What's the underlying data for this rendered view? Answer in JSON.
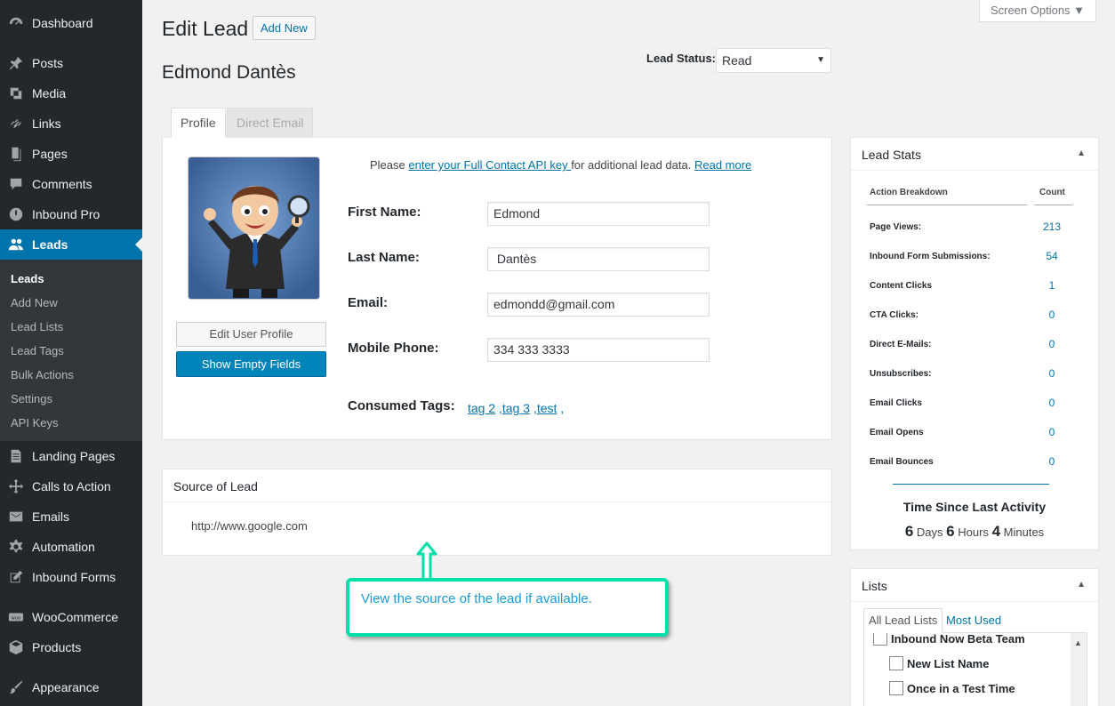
{
  "sidebar": {
    "items": [
      {
        "label": "Dashboard",
        "icon": "dashboard-icon"
      },
      {
        "label": "Posts",
        "icon": "pin-icon"
      },
      {
        "label": "Media",
        "icon": "media-icon"
      },
      {
        "label": "Links",
        "icon": "link-icon"
      },
      {
        "label": "Pages",
        "icon": "page-icon"
      },
      {
        "label": "Comments",
        "icon": "comment-icon"
      },
      {
        "label": "Inbound Pro",
        "icon": "power-icon"
      },
      {
        "label": "Leads",
        "icon": "users-icon"
      },
      {
        "label": "Landing Pages",
        "icon": "document-icon"
      },
      {
        "label": "Calls to Action",
        "icon": "move-icon"
      },
      {
        "label": "Emails",
        "icon": "envelope-icon"
      },
      {
        "label": "Automation",
        "icon": "gear-icon"
      },
      {
        "label": "Inbound Forms",
        "icon": "edit-icon"
      },
      {
        "label": "WooCommerce",
        "icon": "woo-icon"
      },
      {
        "label": "Products",
        "icon": "box-icon"
      },
      {
        "label": "Appearance",
        "icon": "brush-icon"
      }
    ],
    "submenu": [
      "Leads",
      "Add New",
      "Lead Lists",
      "Lead Tags",
      "Bulk Actions",
      "Settings",
      "API Keys"
    ]
  },
  "header": {
    "title": "Edit Lead",
    "add_new": "Add New",
    "screen_options": "Screen Options ▼",
    "lead_name": "Edmond Dantès",
    "lead_status_label": "Lead Status:",
    "lead_status_value": "Read"
  },
  "tabs": {
    "profile": "Profile",
    "direct_email": "Direct Email"
  },
  "profile": {
    "notice_prefix": "Please ",
    "notice_link": "enter your Full Contact API key ",
    "notice_mid": "for additional lead data. ",
    "notice_more": "Read more",
    "edit_profile": "Edit User Profile",
    "show_empty": "Show Empty Fields",
    "first_name_label": "First Name:",
    "first_name": "Edmond",
    "last_name_label": "Last Name:",
    "last_name": " Dantès",
    "email_label": "Email:",
    "email": "edmondd@gmail.com",
    "phone_label": "Mobile Phone:",
    "phone": "334 333 3333",
    "tags_label": "Consumed Tags:",
    "tags": [
      "tag 2",
      "tag 3",
      "test"
    ]
  },
  "source": {
    "title": "Source of Lead",
    "url": "http://www.google.com"
  },
  "callout": {
    "text": "View the source of the lead if available."
  },
  "lead_stats": {
    "title": "Lead Stats",
    "head_action": "Action Breakdown",
    "head_count": "Count",
    "rows": [
      {
        "label": "Page Views:",
        "count": "213"
      },
      {
        "label": "Inbound Form Submissions:",
        "count": "54"
      },
      {
        "label": "Content Clicks",
        "count": "1"
      },
      {
        "label": "CTA Clicks:",
        "count": "0"
      },
      {
        "label": "Direct E-Mails:",
        "count": "0"
      },
      {
        "label": "Unsubscribes:",
        "count": "0"
      },
      {
        "label": "Email Clicks",
        "count": "0"
      },
      {
        "label": "Email Opens",
        "count": "0"
      },
      {
        "label": "Email Bounces",
        "count": "0"
      }
    ],
    "time_title": "Time Since Last Activity",
    "days": "6",
    "days_label": "Days",
    "hours": "6",
    "hours_label": "Hours",
    "minutes": "4",
    "minutes_label": "Minutes"
  },
  "lists": {
    "title": "Lists",
    "tab_all": "All Lead Lists",
    "tab_most": "Most Used",
    "items": [
      "Inbound Now Beta Team",
      "New List Name",
      "Once in a Test Time"
    ]
  }
}
